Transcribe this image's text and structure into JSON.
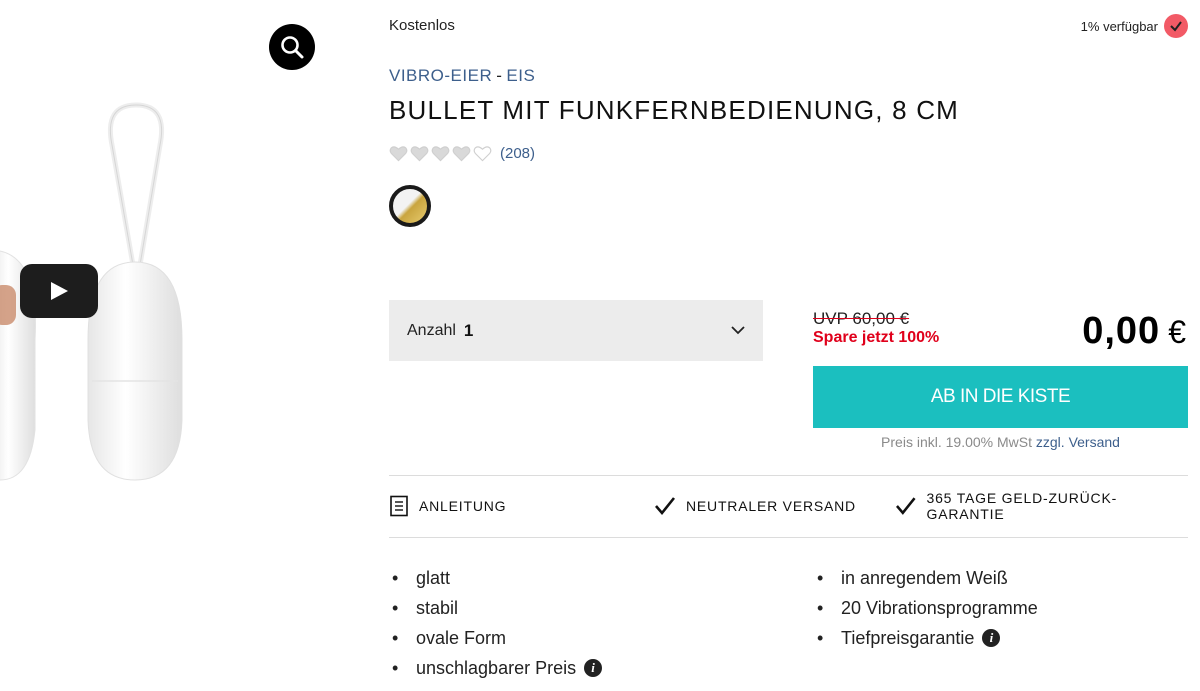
{
  "top": {
    "shipping_note": "Kostenlos",
    "availability": "1% verfügbar"
  },
  "breadcrumb": {
    "category": "VIBRO-EIER",
    "separator": "-",
    "subcategory": "EIS"
  },
  "product": {
    "title": "BULLET MIT FUNKFERNBEDIENUNG, 8 CM",
    "rating": 4,
    "rating_max": 5,
    "review_count": "(208)",
    "swatch_colors": [
      "#f3f3f3",
      "#c9a53f"
    ]
  },
  "quantity": {
    "label": "Anzahl",
    "value": "1"
  },
  "pricing": {
    "uvp": "UVP 60,00 €",
    "savings": "Spare jetzt 100%",
    "price": "0,00",
    "currency": "€"
  },
  "cart": {
    "button_label": "AB IN DIE KISTE",
    "tax_note": "Preis inkl. 19.00% MwSt",
    "shipping_link": "zzgl. Versand"
  },
  "features": {
    "manual": "ANLEITUNG",
    "neutral_shipping": "NEUTRALER VERSAND",
    "guarantee": "365 TAGE GELD-ZURÜCK-GARANTIE"
  },
  "bullets_left": [
    "glatt",
    "stabil",
    "ovale Form",
    "unschlagbarer Preis"
  ],
  "bullets_right": [
    "in anregendem Weiß",
    "20 Vibrationsprogramme",
    "Tiefpreisgarantie"
  ],
  "colors": {
    "accent_teal": "#1bbfbf",
    "link_blue": "#3d5f8c",
    "sale_red": "#e0001b",
    "availability_red": "#f25a66"
  }
}
